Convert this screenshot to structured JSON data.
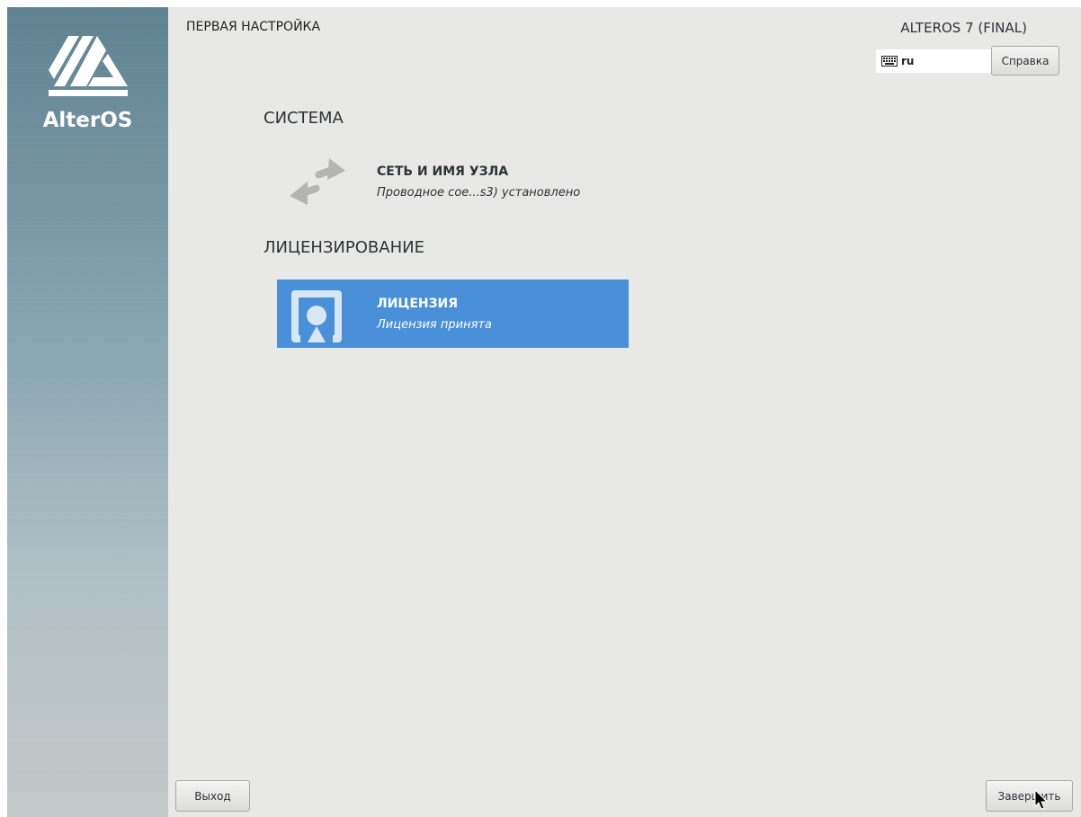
{
  "app": {
    "header_title": "ПЕРВАЯ НАСТРОЙКА",
    "product_title": "ALTEROS 7 (FINAL)",
    "logo_text": "AlterOS"
  },
  "keyboard": {
    "icon": "keyboard-icon",
    "layout": "ru"
  },
  "buttons": {
    "help": "Справка",
    "quit": "Выход",
    "finish": "Завершить"
  },
  "categories": [
    {
      "title": "СИСТЕМА",
      "spokes": [
        {
          "title": "СЕТЬ И ИМЯ УЗЛА",
          "status": "Проводное сое...s3) установлено",
          "icon": "network-arrows-icon",
          "selected": false
        }
      ]
    },
    {
      "title": "ЛИЦЕНЗИРОВАНИЕ",
      "spokes": [
        {
          "title": "ЛИЦЕНЗИЯ",
          "status": "Лицензия принята",
          "icon": "license-certificate-icon",
          "selected": true
        }
      ]
    }
  ],
  "colors": {
    "selected_spoke": "#4a90d9",
    "background": "#e8e8e7",
    "sidebar_top": "#5f8291"
  }
}
